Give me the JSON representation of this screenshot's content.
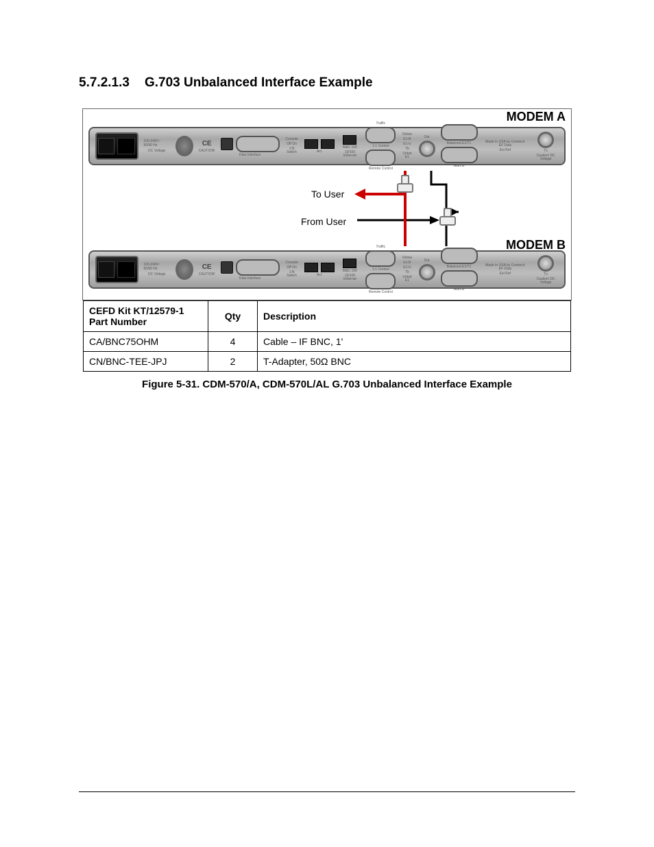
{
  "heading": {
    "number": "5.7.2.1.3",
    "title": "G.703 Unbalanced Interface Example"
  },
  "figure": {
    "modem_a_label": "MODEM A",
    "modem_b_label": "MODEM B",
    "to_user": "To User",
    "from_user": "From User",
    "caption": "Figure 5-31. CDM-570/A, CDM-570L/AL G.703 Unbalanced Interface Example",
    "panel_text": {
      "ce": "CE",
      "caution": "CAUTION!",
      "data_interface": "Data Interface",
      "console": "Console",
      "on_off": "Off On",
      "one_n_switch": "1:N Switch",
      "act": "Act",
      "mc_100": "M&C 100",
      "ethernet_10_100": "10/100 Ethernet",
      "traffic": "Traffic",
      "one_one_control": "1:1 Control",
      "remote_control": "Remote Control",
      "online": "Online",
      "e1_b": "E1-B",
      "e1_u": "E1-U",
      "tb": "Tb",
      "out": "Out",
      "unbal_e1": "Unbal E1",
      "balanced_e1_t1": "Balanced E1/T1",
      "ext_ref": "Ext Ref",
      "alarms": "Alarms",
      "made_in_usa": "Made In USA by Comtech EF Data",
      "tx": "Tx",
      "caution_dc": "Caution! DC Voltage",
      "dc_voltage": "DC Voltage",
      "ac_range": "100-240V~ 60/50 Hz"
    }
  },
  "table": {
    "headers": {
      "part": "CEFD Kit KT/12579-1 Part Number",
      "qty": "Qty",
      "desc": "Description"
    },
    "rows": [
      {
        "part": "CA/BNC75OHM",
        "qty": "4",
        "desc": "Cable – IF BNC, 1'"
      },
      {
        "part": "CN/BNC-TEE-JPJ",
        "qty": "2",
        "desc": "T-Adapter, 50Ω BNC"
      }
    ]
  }
}
